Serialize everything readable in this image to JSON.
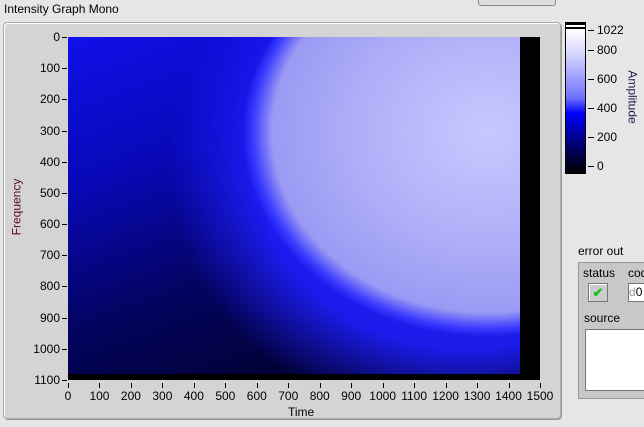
{
  "graph": {
    "title": "Intensity Graph Mono",
    "x_label": "Time",
    "y_label": "Frequency",
    "x_ticks": [
      "0",
      "100",
      "200",
      "300",
      "400",
      "500",
      "600",
      "700",
      "800",
      "900",
      "1000",
      "1100",
      "1200",
      "1300",
      "1400",
      "1500"
    ],
    "y_ticks": [
      "0",
      "100",
      "200",
      "300",
      "400",
      "500",
      "600",
      "700",
      "800",
      "900",
      "1000",
      "1100"
    ]
  },
  "colorbar": {
    "label": "Amplitude",
    "ticks": [
      "0",
      "200",
      "400",
      "600",
      "800"
    ],
    "max": "1022",
    "colors": {
      "low": "#000000",
      "mid": "#0000ff",
      "high": "#ffffff"
    }
  },
  "error_out": {
    "title": "error out",
    "status_label": "status",
    "status_icon": "checkmark-icon",
    "status_value": "✔",
    "code_label": "code",
    "code_prefix": "d",
    "code_value": "0",
    "source_label": "source",
    "source_value": ""
  }
}
